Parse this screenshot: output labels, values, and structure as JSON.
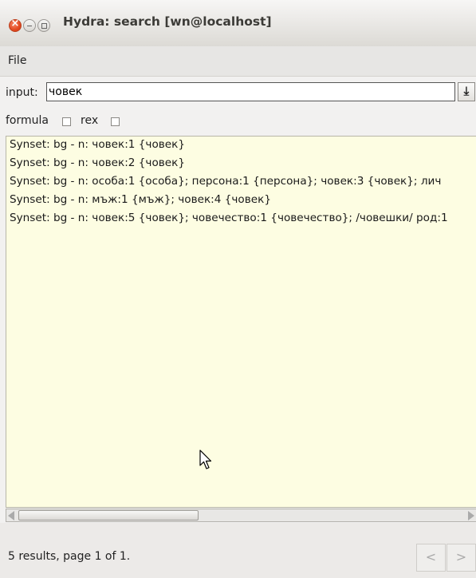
{
  "window": {
    "title": "Hydra: search [wn@localhost]"
  },
  "menu": {
    "file": "File"
  },
  "search": {
    "input_label": "input:",
    "input_value": "човек",
    "go_icon": "download-arrow-icon",
    "formula_label": "formula",
    "formula_checked": false,
    "rex_label": "rex",
    "rex_checked": false
  },
  "results": [
    "Synset: bg - n: човек:1 {човек}",
    "Synset: bg - n: човек:2 {човек}",
    "Synset: bg - n: особа:1 {особа}; персона:1 {персона}; човек:3 {човек}; лич",
    "Synset: bg - n: мъж:1 {мъж}; човек:4 {човек}",
    "Synset: bg - n: човек:5 {човек}; човечество:1 {човечество}; /човешки/ род:1"
  ],
  "status": {
    "text": "5 results, page 1 of 1.",
    "prev_label": "<",
    "next_label": ">"
  },
  "colors": {
    "results_bg": "#fdfde2",
    "close_button": "#e0451c"
  }
}
